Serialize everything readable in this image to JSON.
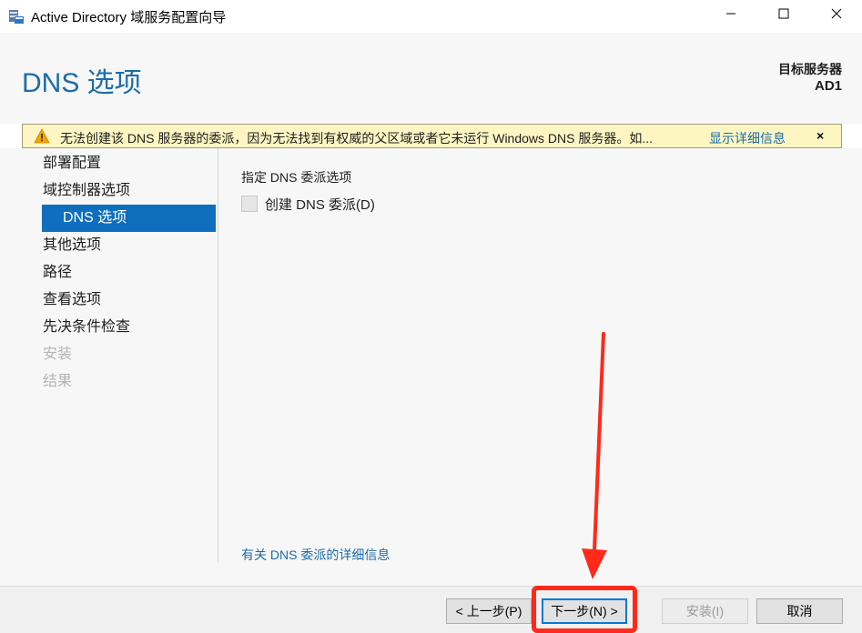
{
  "window": {
    "title": "Active Directory 域服务配置向导",
    "icon": "server-wizard-icon",
    "controls": [
      "minimize-icon",
      "maximize-icon",
      "close-icon"
    ]
  },
  "header": {
    "page_title": "DNS 选项",
    "target_server_label": "目标服务器",
    "target_server_name": "AD1"
  },
  "warning": {
    "icon": "warning-icon",
    "text": "无法创建该 DNS 服务器的委派，因为无法找到有权威的父区域或者它未运行 Windows DNS 服务器。如...",
    "link": "显示详细信息",
    "close": "×"
  },
  "nav": {
    "items": [
      {
        "label": "部署配置",
        "state": "normal"
      },
      {
        "label": "域控制器选项",
        "state": "normal"
      },
      {
        "label": "DNS 选项",
        "state": "selected"
      },
      {
        "label": "其他选项",
        "state": "normal"
      },
      {
        "label": "路径",
        "state": "normal"
      },
      {
        "label": "查看选项",
        "state": "normal"
      },
      {
        "label": "先决条件检查",
        "state": "normal"
      },
      {
        "label": "安装",
        "state": "disabled"
      },
      {
        "label": "结果",
        "state": "disabled"
      }
    ]
  },
  "content": {
    "section_title": "指定 DNS 委派选项",
    "checkbox_label": "创建 DNS 委派(D)",
    "checkbox_checked": false,
    "more_info_link": "有关 DNS 委派的详细信息"
  },
  "footer": {
    "prev_label": "< 上一步(P)",
    "next_label": "下一步(N) >",
    "install_label": "安装(I)",
    "cancel_label": "取消"
  },
  "colors": {
    "accent": "#0f6ebd",
    "title_blue": "#1c6ca8",
    "warning_bg": "#fdf6c3",
    "annotation_red": "#ff2a1a"
  }
}
